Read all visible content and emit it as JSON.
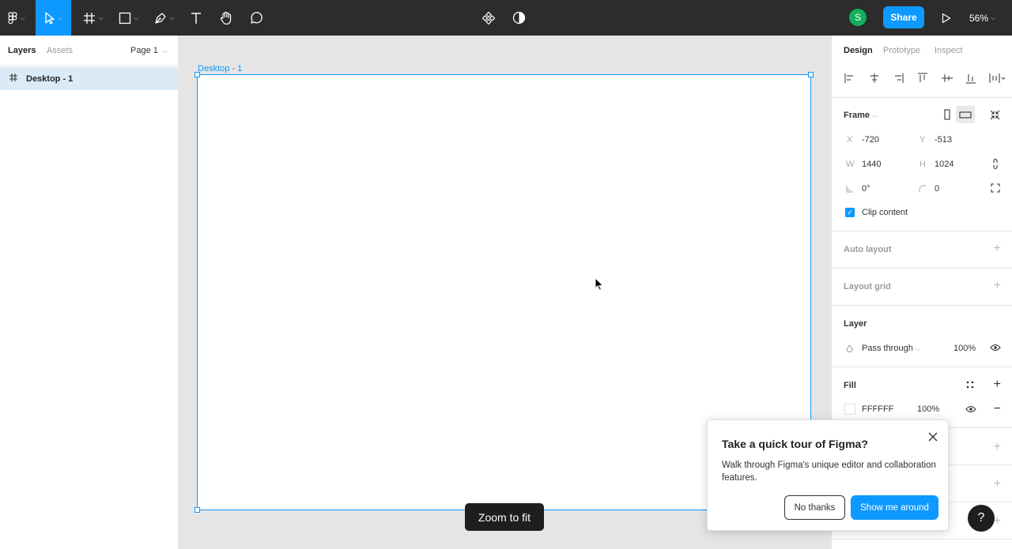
{
  "toolbar": {
    "share_label": "Share",
    "avatar_initial": "S",
    "zoom_label": "56%"
  },
  "left_panel": {
    "tabs": [
      "Layers",
      "Assets"
    ],
    "page_selector": "Page 1",
    "layers": [
      {
        "name": "Desktop - 1"
      }
    ]
  },
  "canvas": {
    "frame_label": "Desktop - 1",
    "zoom_tooltip": "Zoom to fit"
  },
  "right_panel": {
    "tabs": [
      "Design",
      "Prototype",
      "Inspect"
    ],
    "frame": {
      "title": "Frame",
      "x_label": "X",
      "x_value": "-720",
      "y_label": "Y",
      "y_value": "-513",
      "w_label": "W",
      "w_value": "1440",
      "h_label": "H",
      "h_value": "1024",
      "rotation": "0°",
      "radius": "0",
      "clip_label": "Clip content"
    },
    "auto_layout": "Auto layout",
    "layout_grid": "Layout grid",
    "layer": {
      "title": "Layer",
      "blend_mode": "Pass through",
      "opacity": "100%"
    },
    "fill": {
      "title": "Fill",
      "hex": "FFFFFF",
      "opacity": "100%"
    }
  },
  "tour": {
    "title": "Take a quick tour of Figma?",
    "body": "Walk through Figma's unique editor and collaboration features.",
    "no_thanks": "No thanks",
    "show_me": "Show me around"
  },
  "help_label": "?",
  "colors": {
    "accent": "#0d99ff",
    "toolbar_bg": "#2c2c2c",
    "avatar": "#14ae5c"
  }
}
